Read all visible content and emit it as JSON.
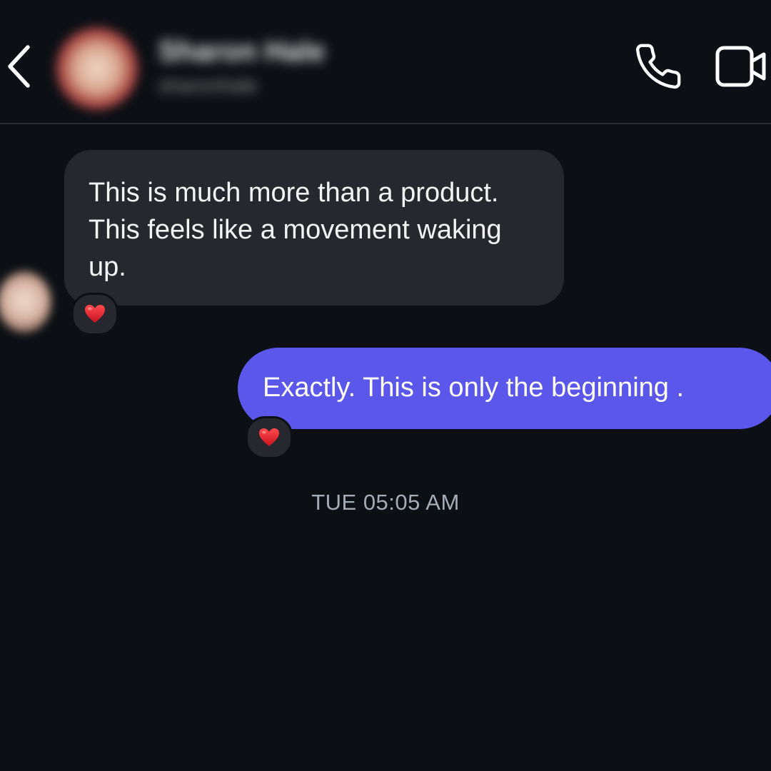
{
  "header": {
    "contact_name": "Sharon Hale",
    "contact_username": "sharonhale",
    "back_icon": "chevron-left-icon",
    "call_icon": "phone-icon",
    "video_icon": "video-camera-icon"
  },
  "messages": [
    {
      "direction": "incoming",
      "text": "This is much more than a product. This feels like a movement waking up.",
      "reaction": "heart"
    },
    {
      "direction": "outgoing",
      "text": "Exactly. This is only the beginning .",
      "reaction": "heart"
    }
  ],
  "timestamp": "TUE 05:05 AM",
  "colors": {
    "background": "#0c1014",
    "incoming_bubble": "#26282d",
    "outgoing_bubble": "#5b57ea",
    "heart": "#e0232e",
    "timestamp_text": "#a5acb5"
  }
}
